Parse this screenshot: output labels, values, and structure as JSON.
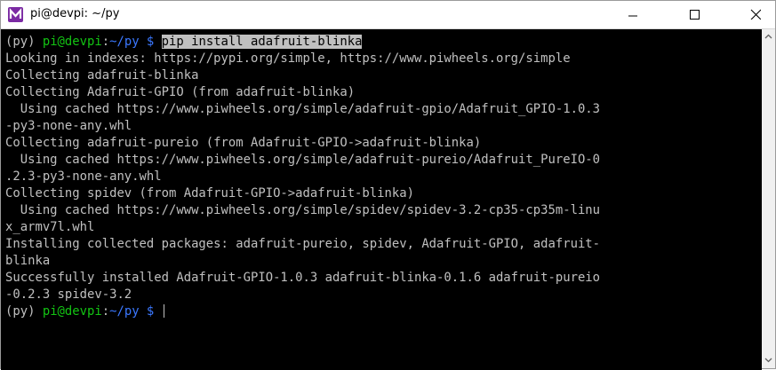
{
  "window": {
    "title": "pi@devpi: ~/py",
    "icon": "app-m-icon",
    "accent": "#7b2aa3"
  },
  "controls": {
    "minimize": "minimize-icon",
    "maximize": "maximize-icon",
    "close": "close-icon"
  },
  "terminal": {
    "prompt": {
      "env": "(py) ",
      "userhost": "pi@devpi",
      "colon": ":",
      "path": "~/py $ ",
      "command": "pip install adafruit-blinka"
    },
    "output": [
      "Looking in indexes: https://pypi.org/simple, https://www.piwheels.org/simple",
      "Collecting adafruit-blinka",
      "Collecting Adafruit-GPIO (from adafruit-blinka)",
      "  Using cached https://www.piwheels.org/simple/adafruit-gpio/Adafruit_GPIO-1.0.3",
      "-py3-none-any.whl",
      "Collecting adafruit-pureio (from Adafruit-GPIO->adafruit-blinka)",
      "  Using cached https://www.piwheels.org/simple/adafruit-pureio/Adafruit_PureIO-0",
      ".2.3-py3-none-any.whl",
      "Collecting spidev (from Adafruit-GPIO->adafruit-blinka)",
      "  Using cached https://www.piwheels.org/simple/spidev/spidev-3.2-cp35-cp35m-linu",
      "x_armv7l.whl",
      "Installing collected packages: adafruit-pureio, spidev, Adafruit-GPIO, adafruit-",
      "blinka",
      "Successfully installed Adafruit-GPIO-1.0.3 adafruit-blinka-0.1.6 adafruit-pureio",
      "-0.2.3 spidev-3.2"
    ],
    "final_prompt": {
      "env": "(py) ",
      "userhost": "pi@devpi",
      "colon": ":",
      "path": "~/py $ "
    },
    "colors": {
      "prompt_user": "#13c413",
      "prompt_path": "#3b78ff",
      "text": "#c0c0c0",
      "background": "#000000"
    }
  }
}
